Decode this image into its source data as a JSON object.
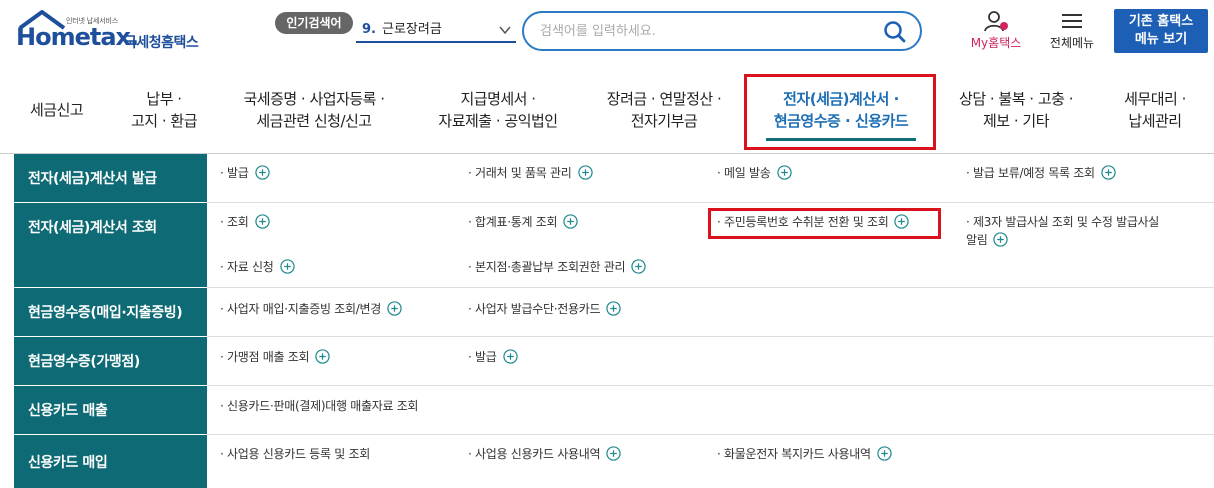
{
  "header": {
    "logo_slogan": "인터넷 납세서비스",
    "logo_brand": "Hometax.",
    "logo_brand_kr": "국세청홈택스",
    "popular_badge": "인기검색어",
    "popular_rank": "9.",
    "popular_term": "근로장려금",
    "search_placeholder": "검색어를 입력하세요.",
    "my_hometax": "My홈택스",
    "all_menu": "전체메뉴",
    "legacy_line1": "기존 홈택스",
    "legacy_line2": "메뉴 보기"
  },
  "gnb": {
    "items": [
      {
        "l1": "세금신고",
        "l2": ""
      },
      {
        "l1": "납부 ·",
        "l2": "고지 · 환급"
      },
      {
        "l1": "국세증명 · 사업자등록 ·",
        "l2": "세금관련 신청/신고"
      },
      {
        "l1": "지급명세서 ·",
        "l2": "자료제출 · 공익법인"
      },
      {
        "l1": "장려금 · 연말정산 ·",
        "l2": "전자기부금"
      },
      {
        "l1": "전자(세금)계산서 ·",
        "l2": "현금영수증 · 신용카드"
      },
      {
        "l1": "상담 · 불복 · 고충 ·",
        "l2": "제보 · 기타"
      },
      {
        "l1": "세무대리 ·",
        "l2": "납세관리"
      }
    ]
  },
  "submenu": {
    "categories": [
      "전자(세금)계산서 발급",
      "전자(세금)계산서 조회",
      "현금영수증(매입·지출증빙)",
      "현금영수증(가맹점)",
      "신용카드 매출",
      "신용카드 매입"
    ],
    "links": {
      "issue": "· 발급",
      "partner": "· 거래처 및 품목 관리",
      "mail": "· 메일 발송",
      "pending": "· 발급 보류/예정 목록 조회",
      "inquiry": "· 조회",
      "summary": "· 합계표·통계 조회",
      "rrn": "· 주민등록번호 수취분 전환 및 조회",
      "third_l1": "· 제3자 발급사실 조회 및 수정 발급사실",
      "third_l2": "알림",
      "data_req": "· 자료 신청",
      "branch": "· 본지점·총괄납부 조회권한 관리",
      "biz_purchase": "· 사업자 매입·지출증빙 조회/변경",
      "biz_card": "· 사업자 발급수단·전용카드",
      "merchant_sales": "· 가맹점 매출 조회",
      "cash_issue": "· 발급",
      "card_agency": "· 신용카드·판매(결제)대행 매출자료 조회",
      "biz_card_reg": "· 사업용 신용카드 등록 및 조회",
      "biz_card_use": "· 사업용 신용카드 사용내역",
      "freight_card": "· 화물운전자 복지카드 사용내역"
    }
  },
  "colors": {
    "brand_blue": "#1e4f9c",
    "side_teal": "#0e6b75",
    "highlight_red": "#d9121b",
    "active_blue": "#1d6fb5"
  }
}
